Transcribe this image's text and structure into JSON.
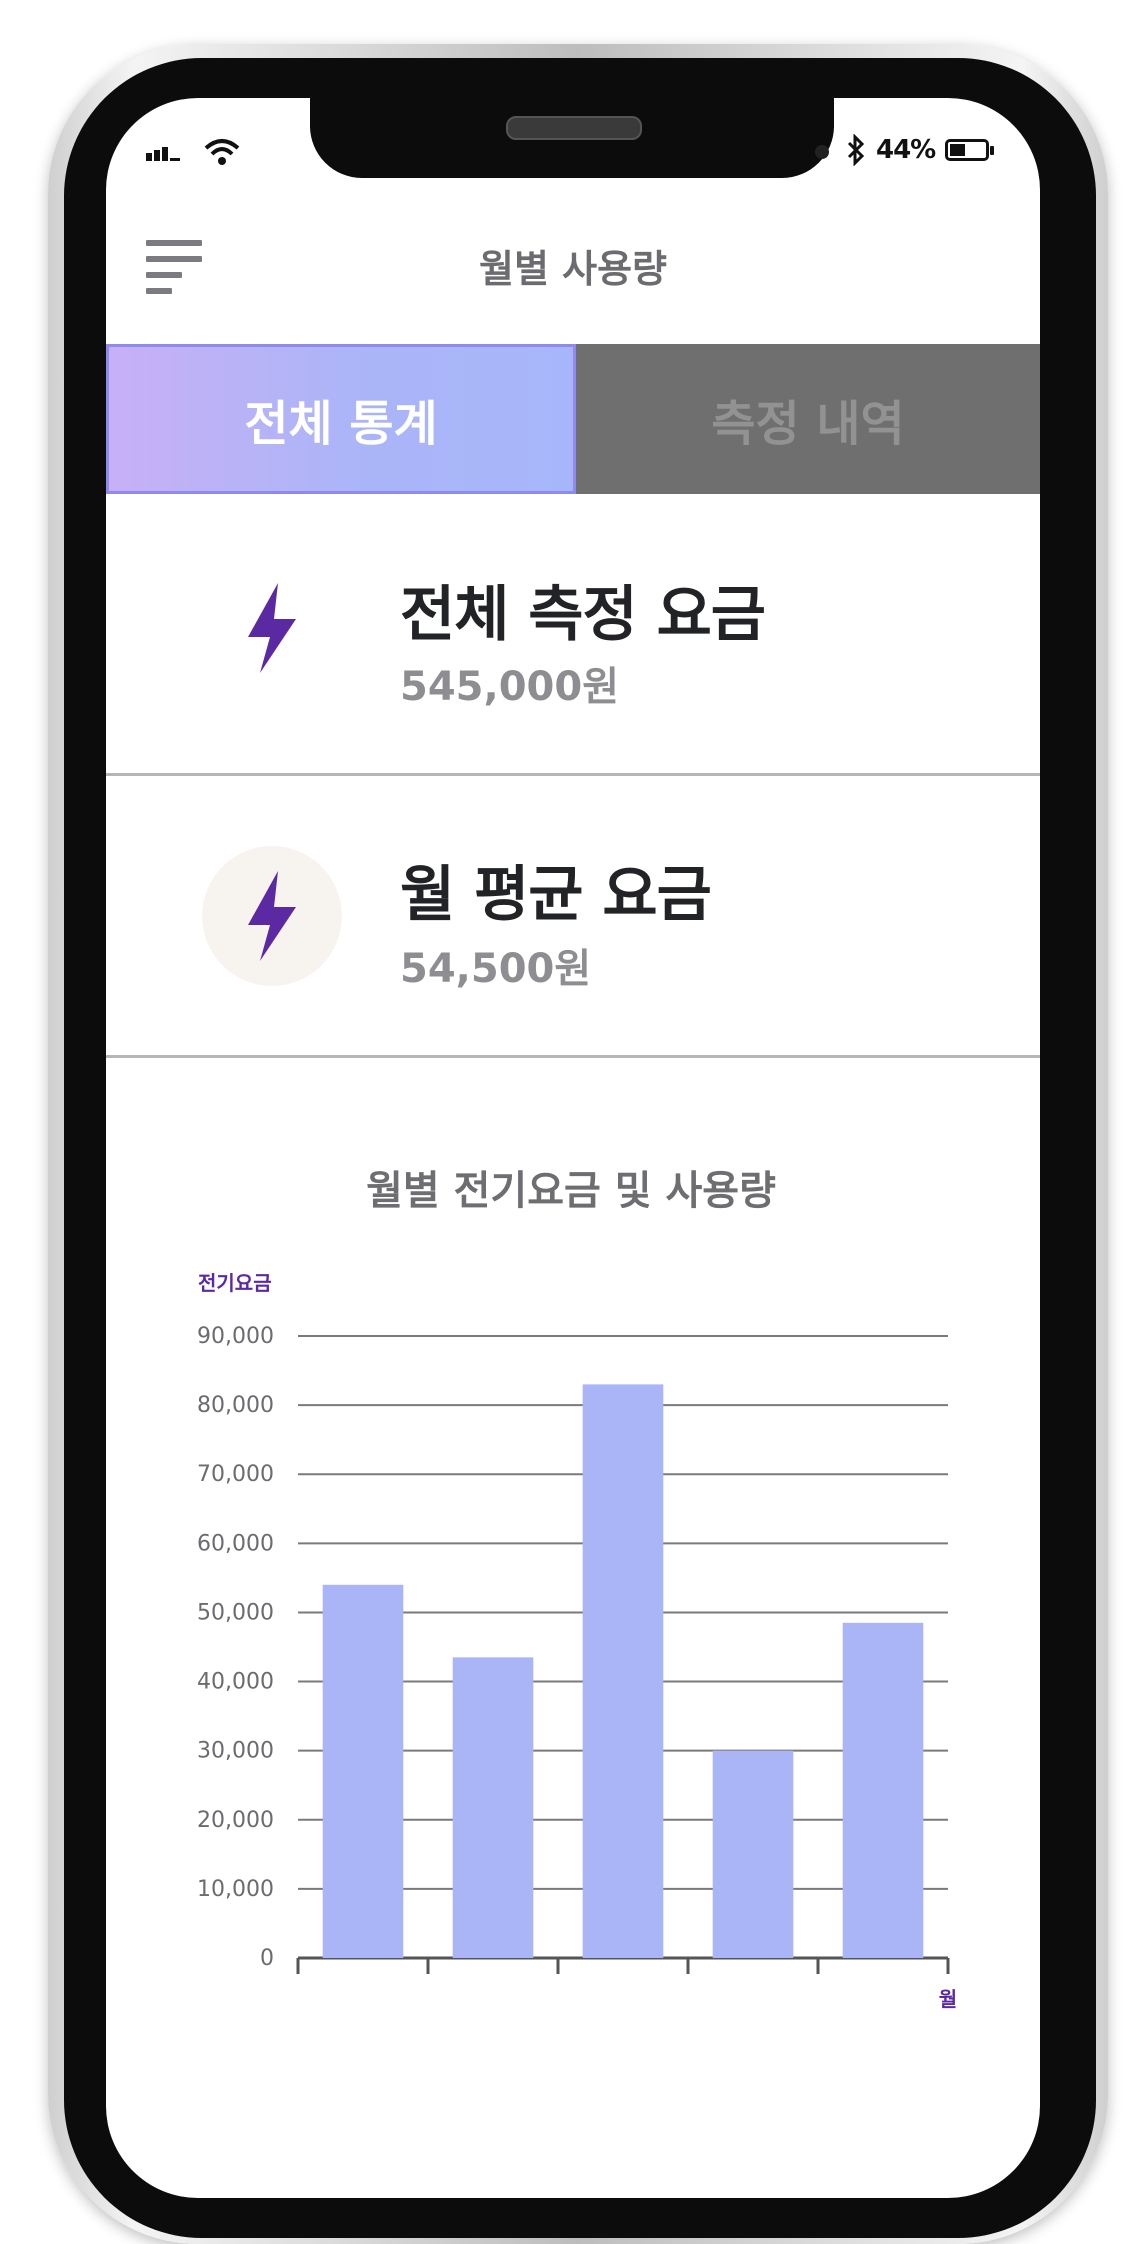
{
  "status_bar": {
    "battery_percent": "44%",
    "battery_level": 0.44,
    "icons": [
      "signal-icon",
      "wifi-icon",
      "bluetooth-icon",
      "battery-icon"
    ]
  },
  "header": {
    "title": "월별 사용량",
    "menu_icon": "hamburger-menu-icon"
  },
  "tabs": [
    {
      "label": "전체 통계",
      "active": true
    },
    {
      "label": "측정 내역",
      "active": false
    }
  ],
  "summary": [
    {
      "title": "전체 측정 요금",
      "value": "545,000원",
      "icon": "lightning-icon"
    },
    {
      "title": "월 평균 요금",
      "value": "54,500원",
      "icon": "lightning-icon"
    }
  ],
  "colors": {
    "accent_purple": "#5b2aa2",
    "bar_color": "#aab5f7",
    "tab_inactive": "#6f6f6f"
  },
  "chart_data": {
    "type": "bar",
    "title": "월별 전기요금 및 사용량",
    "ylabel": "전기요금",
    "xlabel": "월",
    "categories": [
      "",
      "",
      "",
      "",
      ""
    ],
    "values": [
      54000,
      43500,
      83000,
      30000,
      48500
    ],
    "ylim": [
      0,
      90000
    ],
    "yticks": [
      "0",
      "10,000",
      "20,000",
      "30,000",
      "40,000",
      "50,000",
      "60,000",
      "70,000",
      "80,000",
      "90,000"
    ],
    "grid": true
  }
}
